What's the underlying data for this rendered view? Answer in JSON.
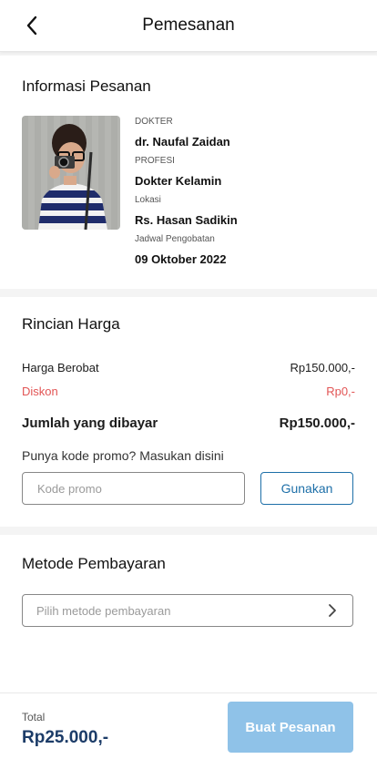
{
  "header": {
    "title": "Pemesanan",
    "back_icon": "chevron-left-icon"
  },
  "order_info": {
    "title": "Informasi Pesanan",
    "fields": [
      {
        "label": "DOKTER",
        "value": "dr. Naufal Zaidan"
      },
      {
        "label": "PROFESI",
        "value": "Dokter Kelamin"
      },
      {
        "label": "Lokasi",
        "value": "Rs. Hasan Sadikin"
      },
      {
        "label": "Jadwal Pengobatan",
        "value": "09 Oktober 2022"
      }
    ]
  },
  "price_details": {
    "title": "Rincian Harga",
    "rows": [
      {
        "label": "Harga Berobat",
        "value": "Rp150.000,-"
      },
      {
        "label": "Diskon",
        "value": "Rp0,-"
      },
      {
        "label": "Jumlah yang dibayar",
        "value": "Rp150.000,-"
      }
    ],
    "promo_hint": "Punya kode promo? Masukan disini",
    "promo_placeholder": "Kode promo",
    "promo_button": "Gunakan"
  },
  "payment_method": {
    "title": "Metode Pembayaran",
    "placeholder": "Pilih metode pembayaran",
    "chevron_icon": "chevron-right-icon"
  },
  "footer": {
    "total_label": "Total",
    "total_value": "Rp25.000,-",
    "order_button": "Buat Pesanan"
  },
  "colors": {
    "accent": "#1d6fa8",
    "discount": "#e25555",
    "button_disabled": "#8fc2e8",
    "total_text": "#1c3c68"
  }
}
